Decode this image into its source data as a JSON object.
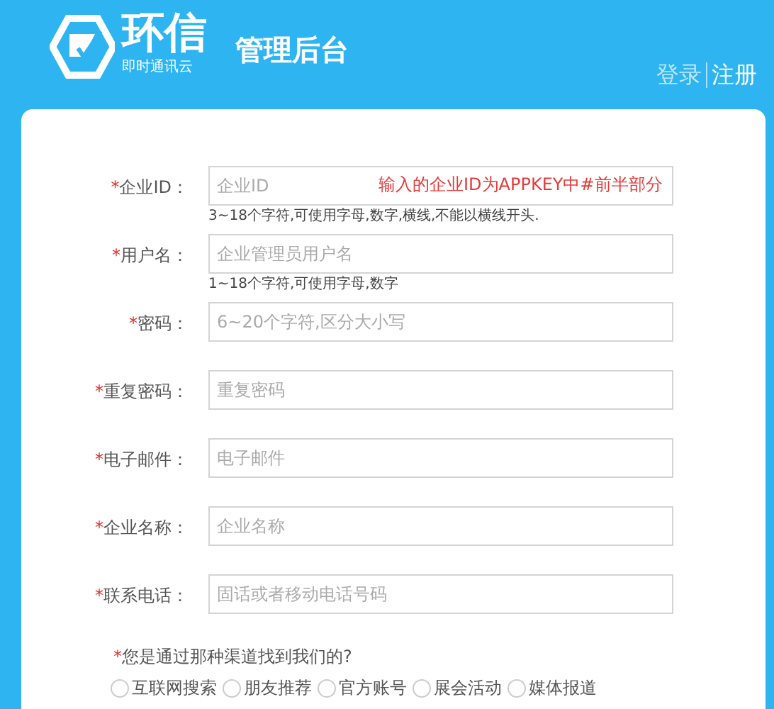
{
  "header": {
    "brand": "环信",
    "tagline": "即时通讯云",
    "title": "管理后台",
    "links": [
      {
        "label": "登录",
        "selected": false
      },
      {
        "label": "注册",
        "selected": true
      }
    ]
  },
  "required_mark": "*",
  "fields": [
    {
      "required": true,
      "label": "企业ID：",
      "placeholder": "企业ID",
      "hint": "3~18个字符,可使用字母,数字,横线,不能以横线开头.",
      "annotation": "输入的企业ID为APPKEY中#前半部分"
    },
    {
      "required": true,
      "label": "用户名：",
      "placeholder": "企业管理员用户名",
      "hint": "1~18个字符,可使用字母,数字"
    },
    {
      "required": true,
      "label": "密码：",
      "placeholder": "6~20个字符,区分大小写"
    },
    {
      "required": true,
      "label": "重复密码：",
      "placeholder": "重复密码"
    },
    {
      "required": true,
      "label": "电子邮件：",
      "placeholder": "电子邮件"
    },
    {
      "required": true,
      "label": "企业名称：",
      "placeholder": "企业名称"
    },
    {
      "required": true,
      "label": "联系电话：",
      "placeholder": "固话或者移动电话号码"
    }
  ],
  "question": {
    "required": true,
    "label": "您是通过那种渠道找到我们的?",
    "options": [
      {
        "label": "互联网搜索",
        "selected": false
      },
      {
        "label": "朋友推荐",
        "selected": false
      },
      {
        "label": "官方账号",
        "selected": false
      },
      {
        "label": "展会活动",
        "selected": false
      },
      {
        "label": "媒体报道",
        "selected": false
      }
    ]
  }
}
